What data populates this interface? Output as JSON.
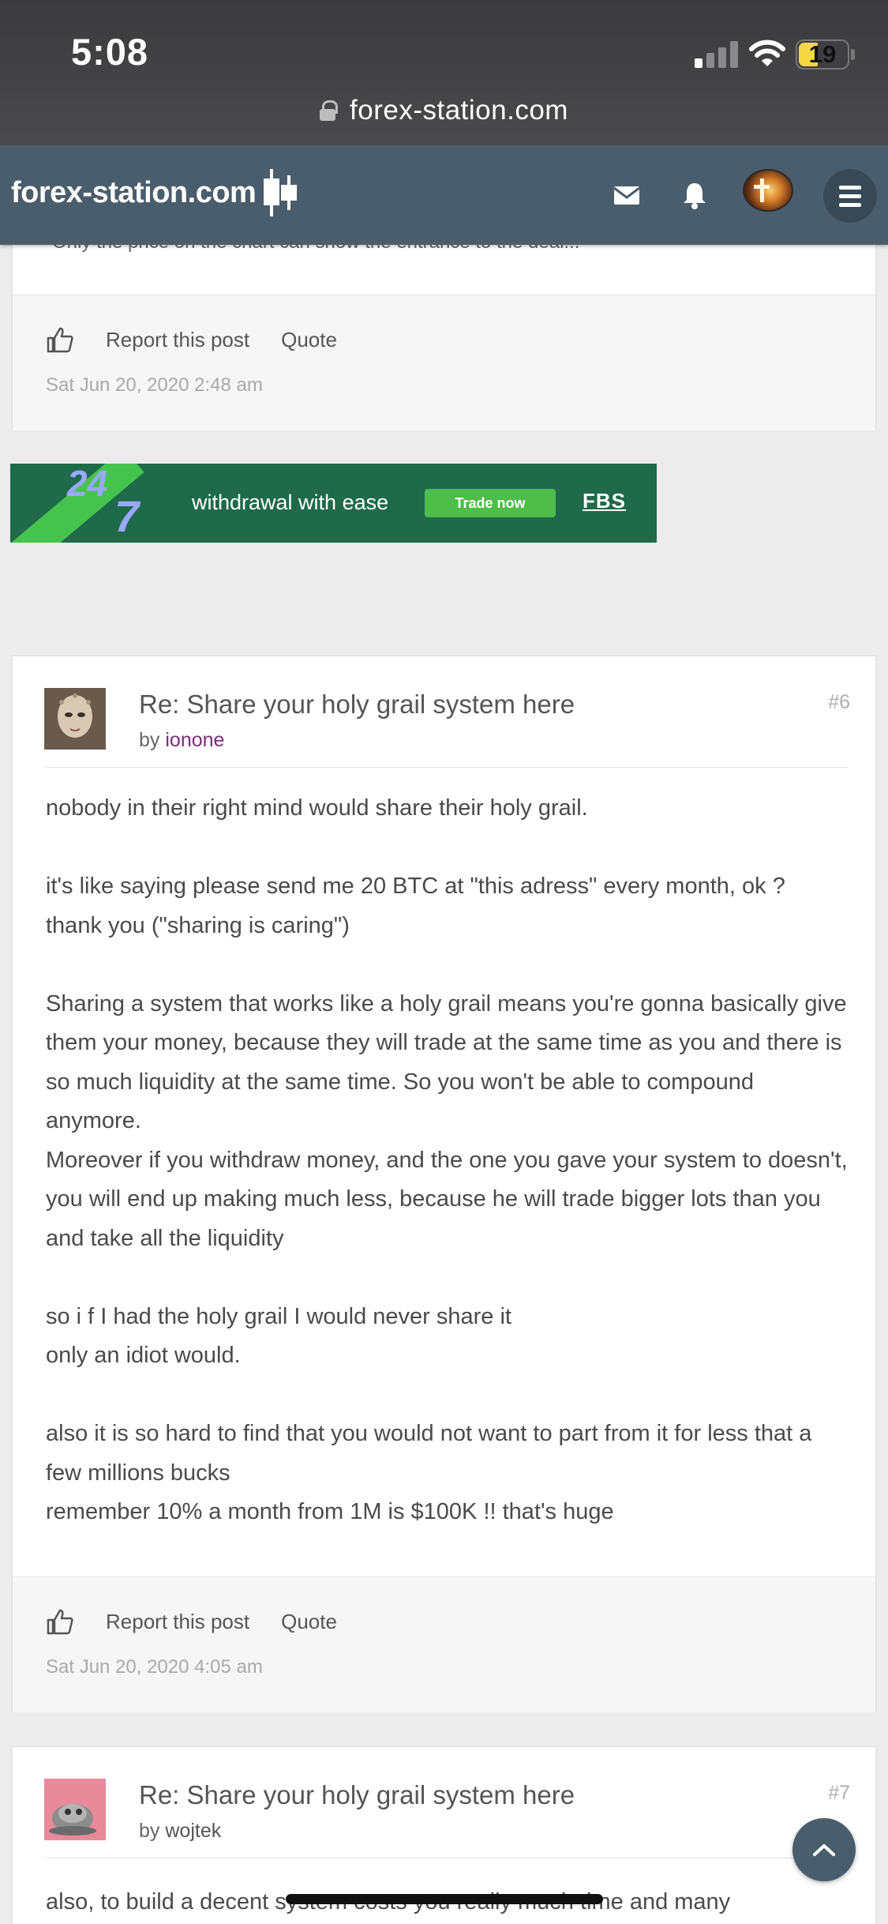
{
  "status_bar": {
    "time": "5:08",
    "battery_level": "19"
  },
  "browser": {
    "url": "forex-station.com"
  },
  "header": {
    "logo_text": "forex-station.com",
    "icons": [
      "mail-icon",
      "bell-icon",
      "avatar",
      "menu-icon"
    ],
    "colors": {
      "header_bg": "#4a5d6c",
      "author_link": "#7b2b7b"
    }
  },
  "prev_post": {
    "snippet": "Only the price on the chart can show the entrance to the deal...",
    "report_label": "Report this post",
    "quote_label": "Quote",
    "date": "Sat Jun 20, 2020 2:48 am"
  },
  "ad": {
    "badge": "24",
    "badge_seven": "7",
    "text": "withdrawal with ease",
    "cta": "Trade now",
    "brand": "FBS"
  },
  "posts": [
    {
      "title": "Re: Share your holy grail system here",
      "by_label": "by",
      "author": "ionone",
      "number": "#6",
      "paragraphs": [
        "nobody in their right mind would share their holy grail.",
        "it's like saying please send me 20 BTC at \"this adress\" every month, ok ?\nthank you (\"sharing is caring\")",
        "Sharing a system that works like a holy grail means you're gonna basically give them your money, because they will trade at the same time as you and there is so much liquidity at the same time. So you won't be able to compound anymore.\nMoreover if you withdraw money, and the one you gave your system to doesn't, you will end up making much less, because he will trade bigger lots than you and take all the liquidity",
        "so i f I had the holy grail I would never share it\nonly an idiot would.",
        "also it is so hard to find that you would not want to part from it for less that a few millions bucks\nremember 10% a month from 1M is $100K !! that's huge"
      ],
      "report_label": "Report this post",
      "quote_label": "Quote",
      "date": "Sat Jun 20, 2020 4:05 am"
    },
    {
      "title": "Re: Share your holy grail system here",
      "by_label": "by",
      "author": "wojtek",
      "number": "#7",
      "paragraphs": [
        "also, to build a decent system costs you really much time and many"
      ]
    }
  ]
}
